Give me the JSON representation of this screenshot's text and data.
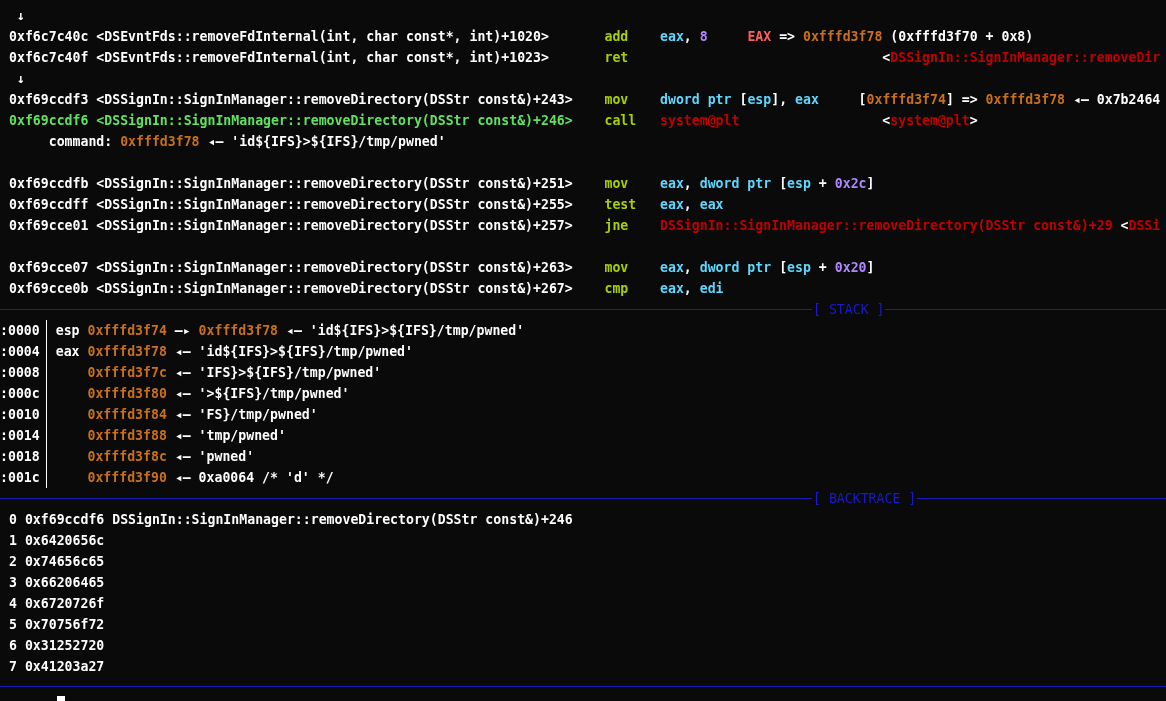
{
  "disasm": [
    {
      "kind": "arrow",
      "text": "↓"
    },
    {
      "kind": "insn",
      "current": false,
      "location": "0xf6c7c40c <DSEvntFds::removeFdInternal(int, char const*, int)+1020>",
      "mnemonic": "add",
      "operands": [
        {
          "t": "eax",
          "kind": "reg"
        },
        {
          "t": ", ",
          "kind": "plain"
        },
        {
          "t": "8",
          "kind": "imm"
        }
      ],
      "annotation": {
        "kind": "value",
        "tokens": [
          {
            "t": "EAX",
            "kind": "regname"
          },
          {
            "t": " => ",
            "kind": "plain"
          },
          {
            "t": "0xfffd3f78",
            "kind": "addr"
          },
          {
            "t": " (0xfffd3f70 + 0x8)",
            "kind": "plain"
          }
        ]
      }
    },
    {
      "kind": "insn",
      "current": false,
      "location": "0xf6c7c40f <DSEvntFds::removeFdInternal(int, char const*, int)+1023>",
      "mnemonic": "ret",
      "annotation": {
        "kind": "target",
        "tokens": [
          {
            "t": "<",
            "kind": "plain"
          },
          {
            "t": "DSSignIn::SignInManager::removeDir",
            "kind": "sym"
          }
        ]
      }
    },
    {
      "kind": "arrow",
      "text": "↓"
    },
    {
      "kind": "insn",
      "current": false,
      "location": "0xf69ccdf3 <DSSignIn::SignInManager::removeDirectory(DSStr const&)+243>",
      "mnemonic": "mov",
      "operands": [
        {
          "t": "dword ptr ",
          "kind": "reg"
        },
        {
          "t": "[",
          "kind": "plain"
        },
        {
          "t": "esp",
          "kind": "reg"
        },
        {
          "t": "], ",
          "kind": "plain"
        },
        {
          "t": "eax",
          "kind": "reg"
        }
      ],
      "annotation": {
        "kind": "value",
        "tokens": [
          {
            "t": "[",
            "kind": "plain"
          },
          {
            "t": "0xfffd3f74",
            "kind": "addr"
          },
          {
            "t": "] => ",
            "kind": "plain"
          },
          {
            "t": "0xfffd3f78",
            "kind": "addr"
          },
          {
            "t": " ◂— 0x7b2464",
            "kind": "plain"
          }
        ]
      }
    },
    {
      "kind": "insn",
      "current": true,
      "location": "0xf69ccdf6 <DSSignIn::SignInManager::removeDirectory(DSStr const&)+246>",
      "mnemonic": "call",
      "operands": [
        {
          "t": "system@plt",
          "kind": "sym"
        }
      ],
      "annotation": {
        "kind": "target",
        "tokens": [
          {
            "t": "<",
            "kind": "plain"
          },
          {
            "t": "system@plt",
            "kind": "sym"
          },
          {
            "t": ">",
            "kind": "plain"
          }
        ]
      }
    },
    {
      "kind": "note",
      "label": "command:",
      "tokens": [
        {
          "t": "0xfffd3f78",
          "kind": "addr"
        },
        {
          "t": " ◂— 'id${IFS}>${IFS}/tmp/pwned'",
          "kind": "plain"
        }
      ]
    },
    {
      "kind": "blank"
    },
    {
      "kind": "insn",
      "current": false,
      "location": "0xf69ccdfb <DSSignIn::SignInManager::removeDirectory(DSStr const&)+251>",
      "mnemonic": "mov",
      "operands": [
        {
          "t": "eax",
          "kind": "reg"
        },
        {
          "t": ", ",
          "kind": "plain"
        },
        {
          "t": "dword ptr ",
          "kind": "reg"
        },
        {
          "t": "[",
          "kind": "plain"
        },
        {
          "t": "esp",
          "kind": "reg"
        },
        {
          "t": " + ",
          "kind": "plain"
        },
        {
          "t": "0x2c",
          "kind": "imm"
        },
        {
          "t": "]",
          "kind": "plain"
        }
      ]
    },
    {
      "kind": "insn",
      "current": false,
      "location": "0xf69ccdff <DSSignIn::SignInManager::removeDirectory(DSStr const&)+255>",
      "mnemonic": "test",
      "operands": [
        {
          "t": "eax",
          "kind": "reg"
        },
        {
          "t": ", ",
          "kind": "plain"
        },
        {
          "t": "eax",
          "kind": "reg"
        }
      ]
    },
    {
      "kind": "insn",
      "current": false,
      "location": "0xf69cce01 <DSSignIn::SignInManager::removeDirectory(DSStr const&)+257>",
      "mnemonic": "jne",
      "operands": [
        {
          "t": "DSSignIn::SignInManager::removeDirectory(DSStr const&)+29",
          "kind": "sym"
        }
      ],
      "annotation": {
        "kind": "target",
        "tokens": [
          {
            "t": "<",
            "kind": "plain"
          },
          {
            "t": "DSSi",
            "kind": "sym"
          }
        ]
      }
    },
    {
      "kind": "blank"
    },
    {
      "kind": "insn",
      "current": false,
      "location": "0xf69cce07 <DSSignIn::SignInManager::removeDirectory(DSStr const&)+263>",
      "mnemonic": "mov",
      "operands": [
        {
          "t": "eax",
          "kind": "reg"
        },
        {
          "t": ", ",
          "kind": "plain"
        },
        {
          "t": "dword ptr ",
          "kind": "reg"
        },
        {
          "t": "[",
          "kind": "plain"
        },
        {
          "t": "esp",
          "kind": "reg"
        },
        {
          "t": " + ",
          "kind": "plain"
        },
        {
          "t": "0x20",
          "kind": "imm"
        },
        {
          "t": "]",
          "kind": "plain"
        }
      ]
    },
    {
      "kind": "insn",
      "current": false,
      "location": "0xf69cce0b <DSSignIn::SignInManager::removeDirectory(DSStr const&)+267>",
      "mnemonic": "cmp",
      "operands": [
        {
          "t": "eax",
          "kind": "reg"
        },
        {
          "t": ", ",
          "kind": "plain"
        },
        {
          "t": "edi",
          "kind": "reg"
        }
      ]
    }
  ],
  "stack": {
    "title": "[ STACK ]",
    "rows": [
      {
        "offset": ":0000",
        "register": "esp",
        "chain": [
          {
            "t": "0xfffd3f74",
            "kind": "addr"
          },
          {
            "t": " —▸ ",
            "kind": "plain"
          },
          {
            "t": "0xfffd3f78",
            "kind": "addr"
          },
          {
            "t": " ◂— 'id${IFS}>${IFS}/tmp/pwned'",
            "kind": "plain"
          }
        ]
      },
      {
        "offset": ":0004",
        "register": "eax",
        "chain": [
          {
            "t": "0xfffd3f78",
            "kind": "addr"
          },
          {
            "t": " ◂— 'id${IFS}>${IFS}/tmp/pwned'",
            "kind": "plain"
          }
        ]
      },
      {
        "offset": ":0008",
        "chain": [
          {
            "t": "0xfffd3f7c",
            "kind": "addr"
          },
          {
            "t": " ◂— 'IFS}>${IFS}/tmp/pwned'",
            "kind": "plain"
          }
        ]
      },
      {
        "offset": ":000c",
        "chain": [
          {
            "t": "0xfffd3f80",
            "kind": "addr"
          },
          {
            "t": " ◂— '>${IFS}/tmp/pwned'",
            "kind": "plain"
          }
        ]
      },
      {
        "offset": ":0010",
        "chain": [
          {
            "t": "0xfffd3f84",
            "kind": "addr"
          },
          {
            "t": " ◂— 'FS}/tmp/pwned'",
            "kind": "plain"
          }
        ]
      },
      {
        "offset": ":0014",
        "chain": [
          {
            "t": "0xfffd3f88",
            "kind": "addr"
          },
          {
            "t": " ◂— 'tmp/pwned'",
            "kind": "plain"
          }
        ]
      },
      {
        "offset": ":0018",
        "chain": [
          {
            "t": "0xfffd3f8c",
            "kind": "addr"
          },
          {
            "t": " ◂— 'pwned'",
            "kind": "plain"
          }
        ]
      },
      {
        "offset": ":001c",
        "chain": [
          {
            "t": "0xfffd3f90",
            "kind": "addr"
          },
          {
            "t": " ◂— 0xa0064 /* 'd' */",
            "kind": "plain"
          }
        ]
      }
    ]
  },
  "backtrace": {
    "title": "[ BACKTRACE ]",
    "frames": [
      {
        "index": "0",
        "address": "0xf69ccdf6",
        "symbol": "DSSignIn::SignInManager::removeDirectory(DSStr const&)+246"
      },
      {
        "index": "1",
        "address": "0x6420656c"
      },
      {
        "index": "2",
        "address": "0x74656c65"
      },
      {
        "index": "3",
        "address": "0x66206465"
      },
      {
        "index": "4",
        "address": "0x6720726f"
      },
      {
        "index": "5",
        "address": "0x70756f72"
      },
      {
        "index": "6",
        "address": "0x31252720"
      },
      {
        "index": "7",
        "address": "0x41203a27"
      }
    ]
  }
}
